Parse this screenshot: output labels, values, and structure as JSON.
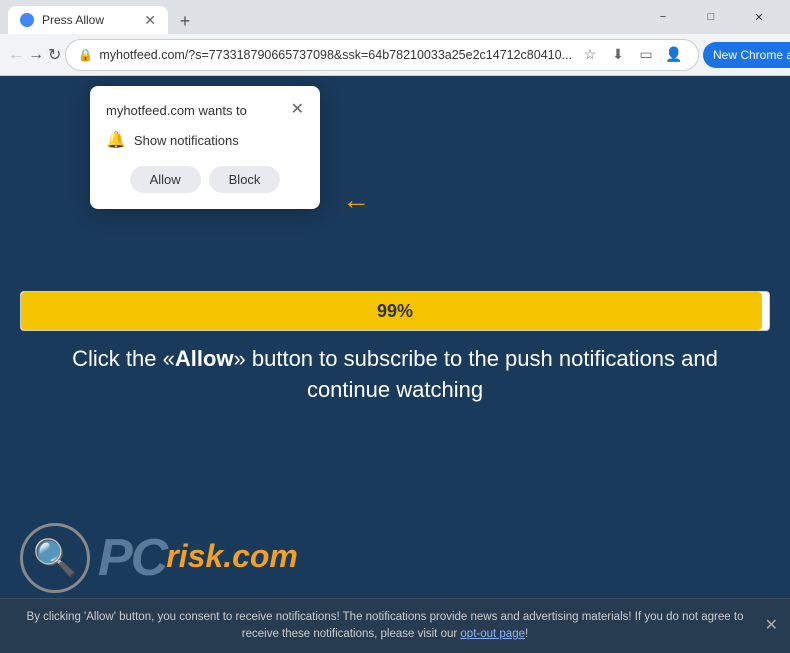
{
  "browser": {
    "tab_title": "Press Allow",
    "url": "myhotfeed.com/?s=773318790665737098&ssk=64b78210033a25e2c14712c80410...",
    "new_chrome_label": "New Chrome available",
    "window_controls": {
      "minimize": "−",
      "maximize": "□",
      "close": "✕"
    }
  },
  "notification_popup": {
    "title": "myhotfeed.com wants to",
    "close_btn": "✕",
    "show_notifications": "Show notifications",
    "allow_label": "Allow",
    "block_label": "Block"
  },
  "progress": {
    "percent": "99%",
    "fill_width": "99%"
  },
  "main_text": {
    "line1": "Click the «Allow» button to subscribe to the push notifications and",
    "line2": "continue watching"
  },
  "logo": {
    "pc": "PC",
    "risk": "risk.com"
  },
  "bottom_bar": {
    "text": "By clicking 'Allow' button, you consent to receive notifications! The notifications provide news and advertising materials! If you do not agree to receive these notifications, please visit our ",
    "link_text": "opt-out page",
    "text_end": "!"
  }
}
